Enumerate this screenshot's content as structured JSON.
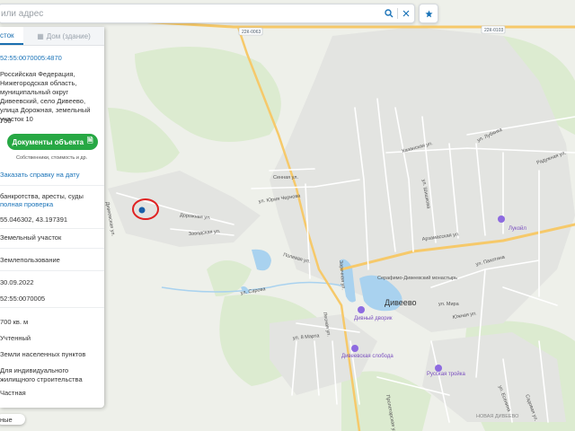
{
  "search": {
    "placeholder": "или адрес"
  },
  "panel": {
    "tabs": [
      {
        "label": "сток"
      },
      {
        "label": "Дом (здание)"
      }
    ],
    "cadastral_number": "52:55:0070005:4870",
    "address": "Российская Федерация, Нижегородская область, муниципальный округ Дивеевский, село Дивеево, улица Дорожная, земельный участок 10",
    "area_short": "700",
    "docs_button": "Документы объекта",
    "docs_note": "Собственники, стоимость и др.",
    "order_report": "Заказать справку на дату",
    "checks_text": "банкротства, аресты, суды",
    "checks_link": "полная проверка",
    "coordinates": "55.046302, 43.197391",
    "object_type": "Земельный участок",
    "object_kind": "Землепользование",
    "date": "30.09.2022",
    "quarter": "52:55:0070005",
    "area_full": "700 кв. м",
    "status": "Учтенный",
    "category": "Земли населенных пунктов",
    "usage": "Для индивидуального жилищного строительства",
    "ownership": "Частная"
  },
  "bottom_pill": "ные",
  "map": {
    "highway_labels": [
      "22К-0063",
      "22К-0103"
    ],
    "streets": [
      "ул. Лубянка",
      "Радужная ул.",
      "Казанская ул.",
      "Сенная ул.",
      "ул. Юрия Чернова",
      "Дорожная ул.",
      "Заводская ул.",
      "Дивеевская ул.",
      "Полевая ул.",
      "Заречная ул.",
      "Арзамасская ул.",
      "ул. Пахотина",
      "ул. Мира",
      "Южная ул.",
      "ул. 8 Марта",
      "ул. Сарова",
      "Лесная ул.",
      "ул. Есенина",
      "Садовая ул.",
      "Пролетарская ул.",
      "ул. Шишкова"
    ],
    "places": {
      "diveevo": "Дивеево",
      "monastery": "Серафимо-Дивеевский монастырь",
      "lukoil": "Лукойл",
      "diveevsky_dvorik": "Дивный дворик",
      "diveevskaya_sloboda": "Дивеевская слобода",
      "russkaya_troika": "Русская тройка",
      "novaya_diveevo": "НОВАЯ ДИВЕЕВО"
    }
  }
}
